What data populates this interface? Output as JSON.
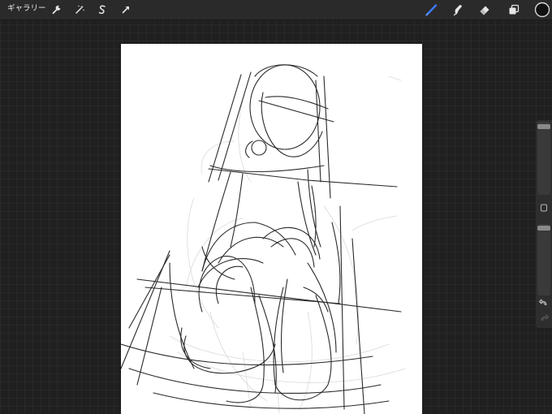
{
  "toolbar": {
    "gallery_label": "ギャラリー",
    "left_tools": [
      {
        "icon": "wrench-icon"
      },
      {
        "icon": "magic-wand-icon"
      },
      {
        "icon": "selection-s-icon"
      },
      {
        "icon": "transform-arrow-icon"
      }
    ],
    "right_tools": [
      {
        "icon": "brush-icon",
        "active": true
      },
      {
        "icon": "smudge-icon"
      },
      {
        "icon": "eraser-icon"
      },
      {
        "icon": "layers-icon"
      },
      {
        "icon": "color-swatch-icon"
      }
    ],
    "accent_color": "#3d7bff",
    "current_color": "#111111"
  },
  "sidebar": {
    "brush_size_level": 0.03,
    "opacity_level": 0.03,
    "modify_button_icon": "square-modify-icon",
    "undo_icon": "undo-icon",
    "redo_icon": "redo-icon"
  }
}
